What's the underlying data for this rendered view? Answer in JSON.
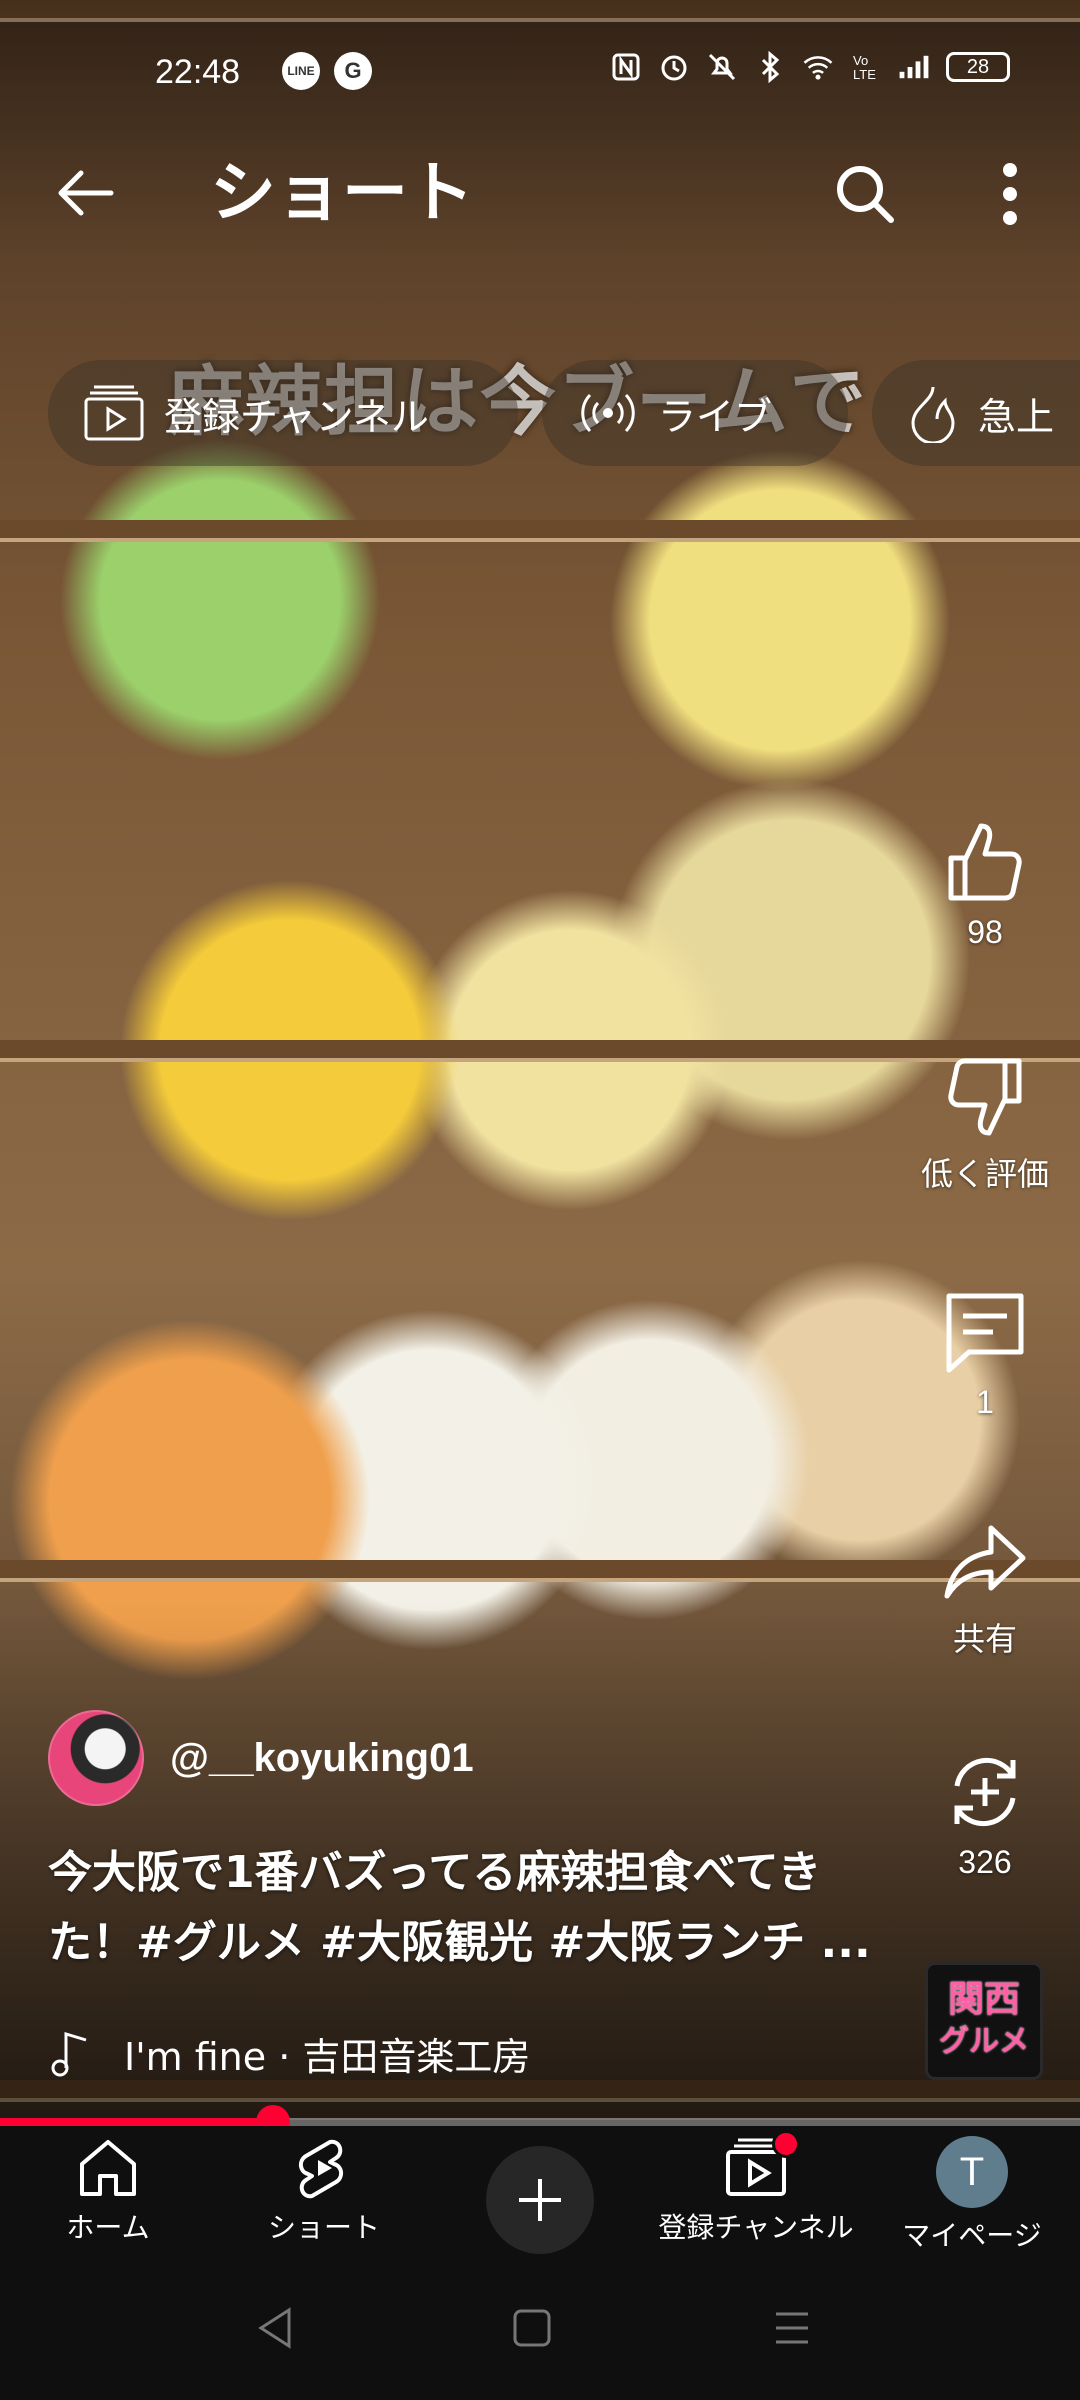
{
  "status_bar": {
    "time": "22:48",
    "app_icons": [
      "LINE",
      "G"
    ],
    "battery": "28",
    "indicator_icons": [
      "nfc-icon",
      "alarm-icon",
      "mute-icon",
      "bluetooth-icon",
      "wifi-icon",
      "volte-icon",
      "signal-icon"
    ]
  },
  "header": {
    "title": "ショート",
    "back_icon": "arrow-left-icon",
    "search_icon": "search-icon",
    "more_icon": "more-vertical-icon"
  },
  "chips": [
    {
      "label": "登録チャンネル",
      "icon": "subscriptions-icon"
    },
    {
      "label": "ライブ",
      "icon": "live-icon"
    },
    {
      "label": "急上",
      "icon": "trending-icon"
    }
  ],
  "video_overlay_text": "麻辣担は今ブームで",
  "actions": {
    "like_count": "98",
    "dislike_label": "低く評価",
    "comment_count": "1",
    "share_label": "共有",
    "remix_count": "326"
  },
  "channel": {
    "handle": "@__koyuking01"
  },
  "description": {
    "line1": "今大阪で1番バズってる麻辣担食べてき",
    "line2": "た！#グルメ #大阪観光 #大阪ランチ ..."
  },
  "music": {
    "track": "I'm fine · 吉田音楽工房"
  },
  "sound_thumb": {
    "line1": "関西",
    "line2": "グルメ"
  },
  "playback": {
    "progress_fraction": 0.253
  },
  "bottom_nav": {
    "home": "ホーム",
    "shorts": "ショート",
    "subscriptions": "登録チャンネル",
    "you": "マイページ",
    "avatar_letter": "T"
  },
  "colors": {
    "accent": "#ff0033",
    "nav_background": "#0f0f0f"
  }
}
